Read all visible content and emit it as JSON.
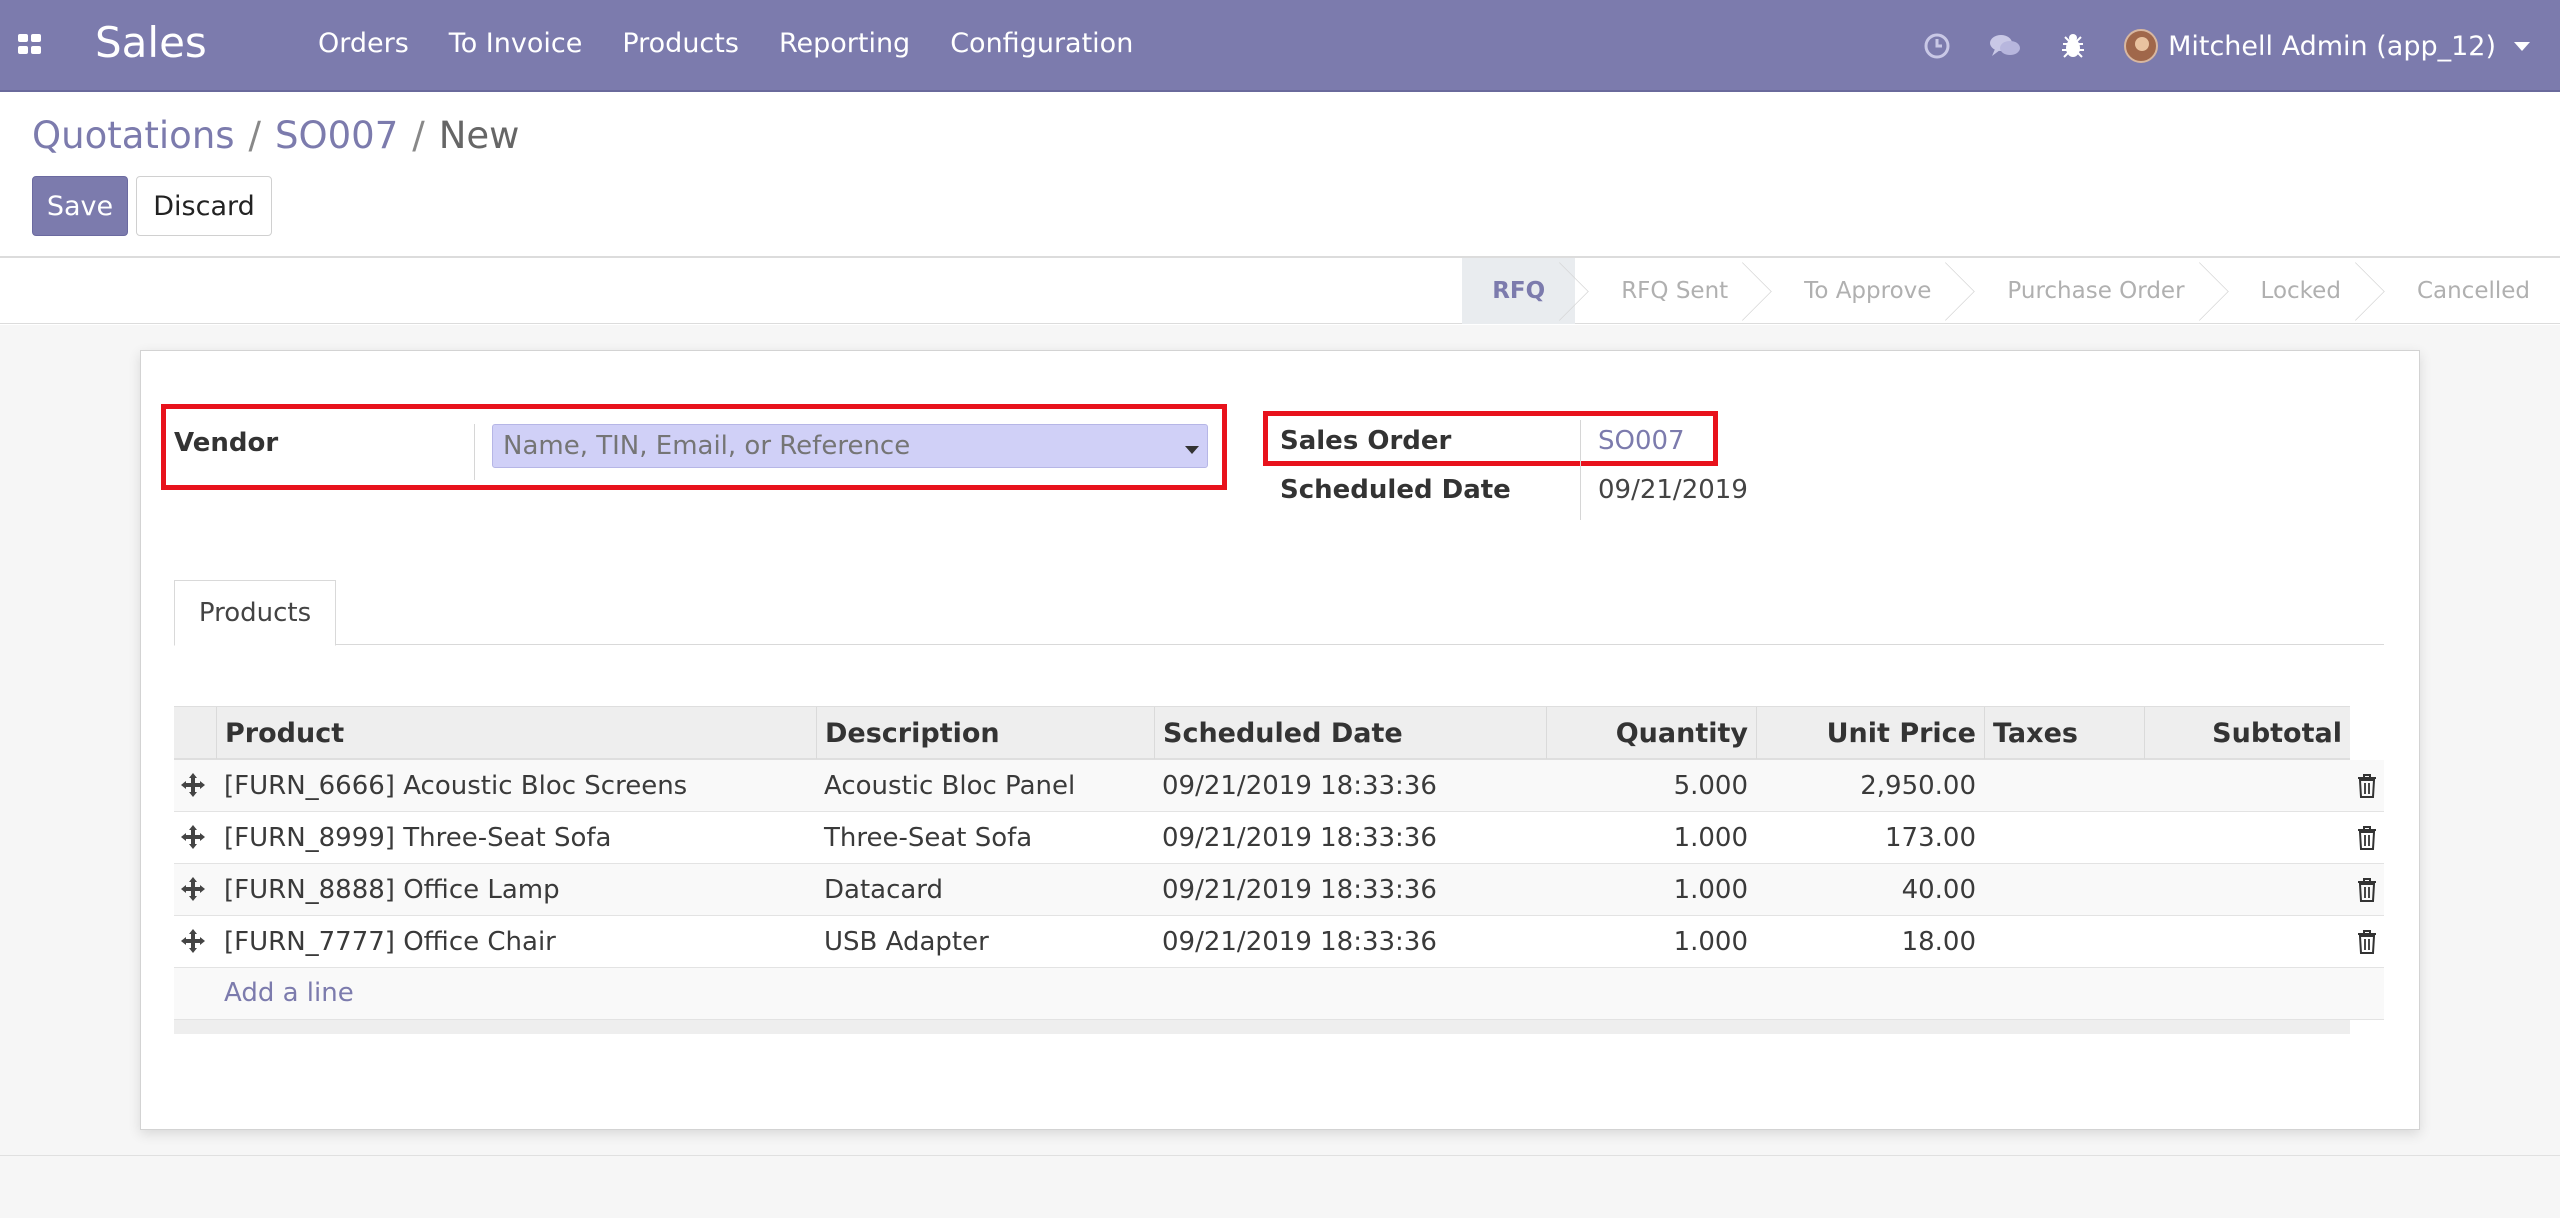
{
  "navbar": {
    "brand": "Sales",
    "menu": [
      "Orders",
      "To Invoice",
      "Products",
      "Reporting",
      "Configuration"
    ],
    "user_name": "Mitchell Admin (app_12)"
  },
  "breadcrumb": {
    "items": [
      "Quotations",
      "SO007"
    ],
    "current": "New",
    "separator": "/"
  },
  "buttons": {
    "save": "Save",
    "discard": "Discard"
  },
  "statusbar": {
    "stages": [
      "RFQ",
      "RFQ Sent",
      "To Approve",
      "Purchase Order",
      "Locked",
      "Cancelled"
    ],
    "active": "RFQ"
  },
  "form": {
    "vendor_label": "Vendor",
    "vendor_placeholder": "Name, TIN, Email, or Reference",
    "vendor_value": "",
    "sales_order_label": "Sales Order",
    "sales_order_value": "SO007",
    "scheduled_date_label": "Scheduled Date",
    "scheduled_date_value": "09/21/2019"
  },
  "tabs": [
    "Products"
  ],
  "table": {
    "headers": [
      "Product",
      "Description",
      "Scheduled Date",
      "Quantity",
      "Unit Price",
      "Taxes",
      "Subtotal"
    ],
    "rows": [
      {
        "product": "[FURN_6666] Acoustic Bloc Screens",
        "description": "Acoustic Bloc Panel",
        "date": "09/21/2019 18:33:36",
        "quantity": "5.000",
        "unit_price": "2,950.00",
        "taxes": "",
        "subtotal": ""
      },
      {
        "product": "[FURN_8999] Three-Seat Sofa",
        "description": "Three-Seat Sofa",
        "date": "09/21/2019 18:33:36",
        "quantity": "1.000",
        "unit_price": "173.00",
        "taxes": "",
        "subtotal": ""
      },
      {
        "product": "[FURN_8888] Office Lamp",
        "description": "Datacard",
        "date": "09/21/2019 18:33:36",
        "quantity": "1.000",
        "unit_price": "40.00",
        "taxes": "",
        "subtotal": ""
      },
      {
        "product": "[FURN_7777] Office Chair",
        "description": "USB Adapter",
        "date": "09/21/2019 18:33:36",
        "quantity": "1.000",
        "unit_price": "18.00",
        "taxes": "",
        "subtotal": ""
      }
    ],
    "add_line": "Add a line"
  },
  "colors": {
    "brand": "#7c7bad",
    "highlight": "#e8121c",
    "input_bg": "#d0d0f7"
  }
}
